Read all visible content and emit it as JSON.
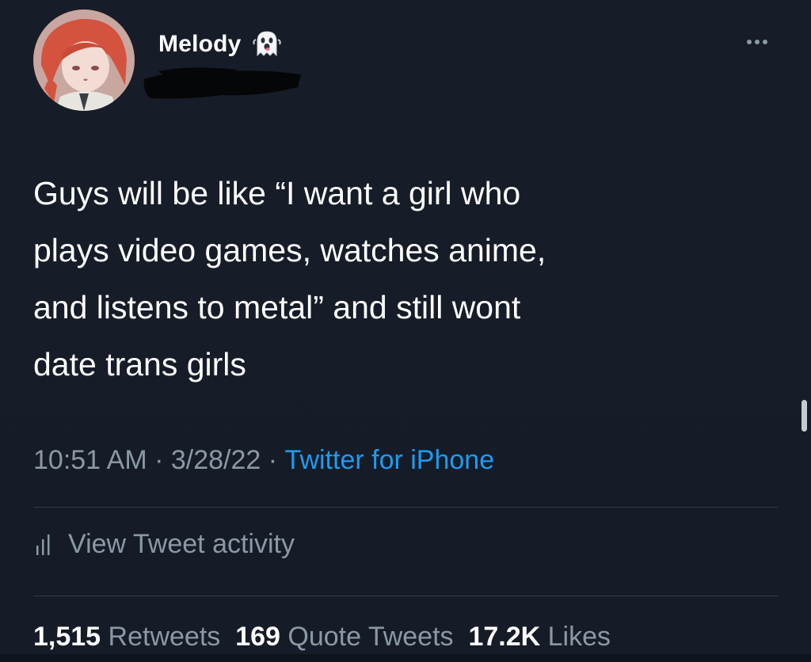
{
  "user": {
    "display_name": "Melody",
    "emoji": "ghost-emoji"
  },
  "tweet": {
    "lines": [
      "Guys will be like “I want a girl who",
      "plays video games, watches anime,",
      "and listens to metal” and still wont",
      "date trans girls"
    ]
  },
  "meta": {
    "time": "10:51 AM",
    "date": "3/28/22",
    "source": "Twitter for iPhone",
    "separator": " · "
  },
  "activity": {
    "label": "View Tweet activity",
    "icon": "bar-chart-icon"
  },
  "stats": {
    "retweets_count": "1,515",
    "retweets_label": "Retweets",
    "quotes_count": "169",
    "quotes_label": "Quote Tweets",
    "likes_count": "17.2K",
    "likes_label": "Likes"
  },
  "colors": {
    "background": "#15202b",
    "text": "#ffffff",
    "secondary": "#8b98a5",
    "link": "#1d9bf0"
  }
}
